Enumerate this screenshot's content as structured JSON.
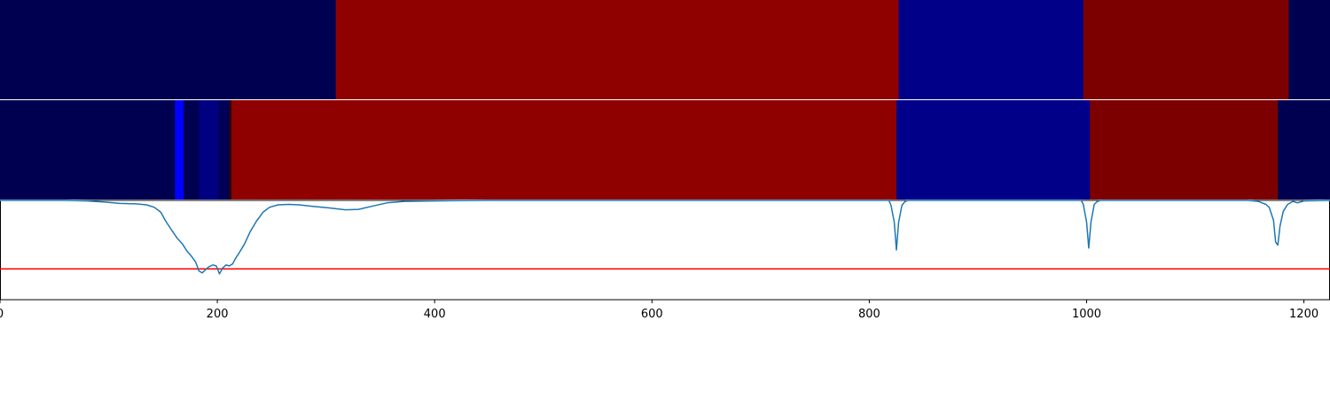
{
  "colors": {
    "curve": "#1f77b4",
    "threshold_line": "#ff0000",
    "separator": "#ffffff",
    "axis": "#000000"
  },
  "chart_data": [
    {
      "type": "heatmap",
      "panel": "top-strip",
      "xlim": [
        0,
        1224
      ],
      "segments": [
        {
          "start": 0,
          "end": 309,
          "color": "#000050"
        },
        {
          "start": 309,
          "end": 827,
          "color": "#8f0000"
        },
        {
          "start": 827,
          "end": 997,
          "color": "#000088"
        },
        {
          "start": 997,
          "end": 1186,
          "color": "#7d0000"
        },
        {
          "start": 1186,
          "end": 1224,
          "color": "#000050"
        }
      ]
    },
    {
      "type": "heatmap",
      "panel": "middle-strip",
      "xlim": [
        0,
        1224
      ],
      "segments": [
        {
          "start": 0,
          "end": 161,
          "color": "#000050"
        },
        {
          "start": 161,
          "end": 169,
          "color": "#0000ff"
        },
        {
          "start": 169,
          "end": 183,
          "color": "#000050"
        },
        {
          "start": 183,
          "end": 201,
          "color": "#000080"
        },
        {
          "start": 201,
          "end": 211,
          "color": "#000058"
        },
        {
          "start": 211,
          "end": 213,
          "color": "#300000"
        },
        {
          "start": 213,
          "end": 825,
          "color": "#8f0000"
        },
        {
          "start": 825,
          "end": 1003,
          "color": "#000088"
        },
        {
          "start": 1003,
          "end": 1176,
          "color": "#7d0000"
        },
        {
          "start": 1176,
          "end": 1224,
          "color": "#000050"
        }
      ]
    },
    {
      "type": "line",
      "panel": "bottom-plot",
      "xlim": [
        0,
        1224
      ],
      "ylim": [
        0,
        1
      ],
      "x_ticks": [
        0,
        200,
        400,
        600,
        800,
        1000,
        1200
      ],
      "x_tick_labels": [
        "0",
        "200",
        "400",
        "600",
        "800",
        "1000",
        "1200"
      ],
      "threshold": 0.31,
      "series": [
        {
          "points": [
            [
              0,
              1.0
            ],
            [
              60,
              1.0
            ],
            [
              80,
              0.995
            ],
            [
              95,
              0.985
            ],
            [
              110,
              0.97
            ],
            [
              125,
              0.965
            ],
            [
              135,
              0.955
            ],
            [
              142,
              0.93
            ],
            [
              148,
              0.88
            ],
            [
              152,
              0.8
            ],
            [
              158,
              0.7
            ],
            [
              163,
              0.62
            ],
            [
              168,
              0.56
            ],
            [
              172,
              0.49
            ],
            [
              176,
              0.44
            ],
            [
              180,
              0.38
            ],
            [
              183,
              0.29
            ],
            [
              186,
              0.27
            ],
            [
              189,
              0.3
            ],
            [
              192,
              0.33
            ],
            [
              196,
              0.35
            ],
            [
              199,
              0.34
            ],
            [
              202,
              0.26
            ],
            [
              205,
              0.32
            ],
            [
              208,
              0.35
            ],
            [
              211,
              0.34
            ],
            [
              214,
              0.36
            ],
            [
              217,
              0.42
            ],
            [
              220,
              0.47
            ],
            [
              225,
              0.56
            ],
            [
              230,
              0.68
            ],
            [
              236,
              0.79
            ],
            [
              242,
              0.88
            ],
            [
              248,
              0.93
            ],
            [
              256,
              0.955
            ],
            [
              266,
              0.96
            ],
            [
              275,
              0.955
            ],
            [
              288,
              0.94
            ],
            [
              302,
              0.925
            ],
            [
              318,
              0.905
            ],
            [
              330,
              0.91
            ],
            [
              342,
              0.94
            ],
            [
              356,
              0.975
            ],
            [
              372,
              0.99
            ],
            [
              400,
              0.995
            ],
            [
              450,
              1.0
            ],
            [
              818,
              1.0
            ],
            [
              820,
              0.95
            ],
            [
              823,
              0.78
            ],
            [
              825,
              0.5
            ],
            [
              827,
              0.78
            ],
            [
              830,
              0.95
            ],
            [
              833,
              0.99
            ],
            [
              836,
              1.0
            ],
            [
              995,
              1.0
            ],
            [
              997,
              0.96
            ],
            [
              1000,
              0.78
            ],
            [
              1002,
              0.52
            ],
            [
              1004,
              0.78
            ],
            [
              1007,
              0.96
            ],
            [
              1010,
              0.99
            ],
            [
              1013,
              1.0
            ],
            [
              1148,
              1.0
            ],
            [
              1158,
              0.99
            ],
            [
              1165,
              0.96
            ],
            [
              1168,
              0.93
            ],
            [
              1172,
              0.8
            ],
            [
              1174,
              0.58
            ],
            [
              1176,
              0.55
            ],
            [
              1178,
              0.74
            ],
            [
              1181,
              0.89
            ],
            [
              1185,
              0.96
            ],
            [
              1190,
              0.99
            ],
            [
              1194,
              0.975
            ],
            [
              1200,
              0.995
            ],
            [
              1224,
              1.0
            ]
          ]
        }
      ]
    }
  ]
}
